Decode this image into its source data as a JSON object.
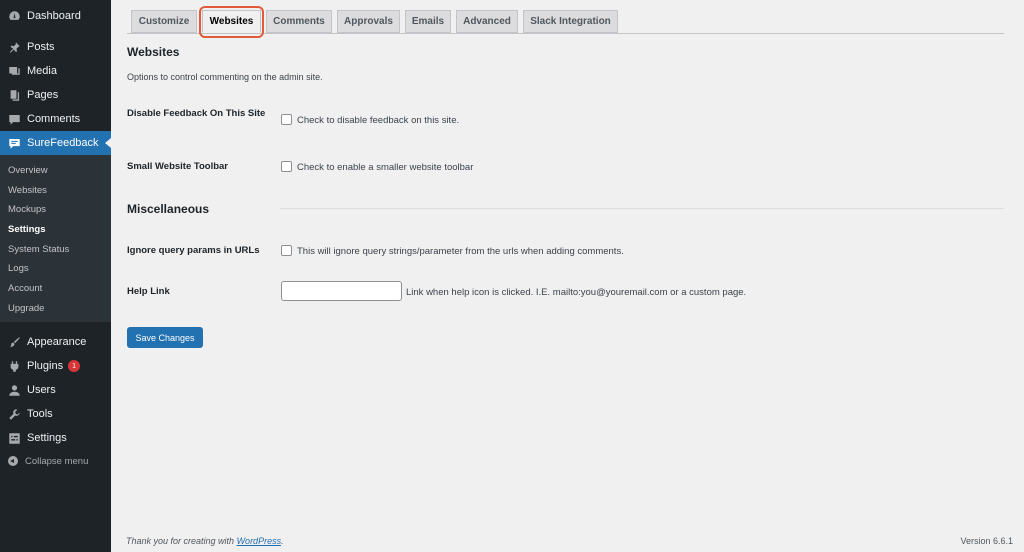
{
  "sidebar": {
    "items": [
      {
        "label": "Dashboard",
        "icon": "dashboard-icon"
      },
      {
        "label": "Posts",
        "icon": "pin-icon"
      },
      {
        "label": "Media",
        "icon": "media-icon"
      },
      {
        "label": "Pages",
        "icon": "pages-icon"
      },
      {
        "label": "Comments",
        "icon": "comment-icon"
      },
      {
        "label": "SureFeedback",
        "icon": "feedback-icon"
      },
      {
        "label": "Appearance",
        "icon": "brush-icon"
      },
      {
        "label": "Plugins",
        "icon": "plugin-icon",
        "badge": "1"
      },
      {
        "label": "Users",
        "icon": "user-icon"
      },
      {
        "label": "Tools",
        "icon": "wrench-icon"
      },
      {
        "label": "Settings",
        "icon": "settings-icon"
      }
    ],
    "submenu": [
      "Overview",
      "Websites",
      "Mockups",
      "Settings",
      "System Status",
      "Logs",
      "Account",
      "Upgrade"
    ],
    "collapse_label": "Collapse menu",
    "active_color": "#2271b1"
  },
  "tabs": [
    "Customize",
    "Websites",
    "Comments",
    "Approvals",
    "Emails",
    "Advanced",
    "Slack Integration"
  ],
  "active_tab": "Websites",
  "highlight_color": "#e05b3a",
  "websites": {
    "title": "Websites",
    "description": "Options to control commenting on the admin site.",
    "disable_feedback_label": "Disable Feedback On This Site",
    "disable_feedback_text": "Check to disable feedback on this site.",
    "small_toolbar_label": "Small Website Toolbar",
    "small_toolbar_text": "Check to enable a smaller website toolbar"
  },
  "misc": {
    "title": "Miscellaneous",
    "ignore_query_label": "Ignore query params in URLs",
    "ignore_query_text": "This will ignore query strings/parameter from the urls when adding comments.",
    "help_link_label": "Help Link",
    "help_link_value": "",
    "help_link_desc": "Link when help icon is clicked. I.E. mailto:you@youremail.com or a custom page."
  },
  "save_label": "Save Changes",
  "footer": {
    "thanks_prefix": "Thank you for creating with ",
    "thanks_link": "WordPress",
    "thanks_suffix": ".",
    "version": "Version 6.6.1"
  }
}
